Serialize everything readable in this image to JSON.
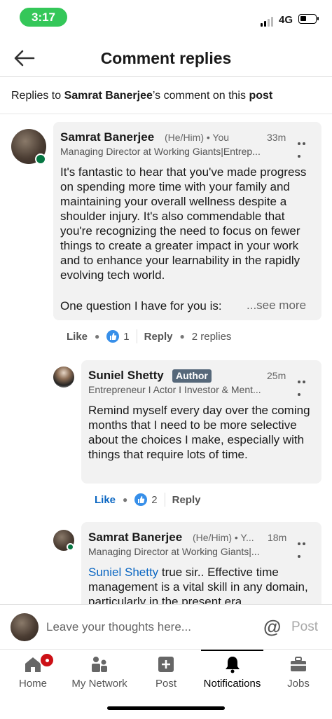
{
  "status_bar": {
    "time": "3:17",
    "network": "4G"
  },
  "header": {
    "title": "Comment replies"
  },
  "subheader": {
    "prefix": "Replies to ",
    "author": "Samrat Banerjee",
    "middle": "’s comment on this ",
    "post_word": "post"
  },
  "main_comment": {
    "name": "Samrat Banerjee",
    "pronoun": "(He/Him) • You",
    "time": "33m",
    "headline": "Managing Director at Working Giants|Entrep...",
    "text": "It's fantastic to hear that you've made progress on spending more time with your family and maintaining your overall wellness despite a shoulder injury. It's also commendable that you're recognizing the need to focus on fewer things to create a greater impact in your work and to enhance your learnability in the rapidly evolving tech world.",
    "last_line": "One question I have for you is:",
    "see_more": "...see more",
    "like_label": "Like",
    "like_count": "1",
    "reply_label": "Reply",
    "replies_count": "2 replies"
  },
  "reply_1": {
    "name": "Suniel Shetty",
    "badge": "Author",
    "time": "25m",
    "headline": "Entrepreneur I Actor I Investor & Ment...",
    "text": "Remind myself every day over the coming months that I need to be more selective about the choices I make, especially with things that require lots of time.",
    "like_label": "Like",
    "like_count": "2",
    "reply_label": "Reply"
  },
  "reply_2": {
    "name": "Samrat Banerjee",
    "pronoun": "(He/Him) • Y...",
    "time": "18m",
    "headline": "Managing Director at Working Giants|...",
    "mention": "Suniel Shetty",
    "text": " true sir.. Effective time management is a vital skill in any domain, particularly in the present era"
  },
  "composer": {
    "placeholder": "Leave your thoughts here...",
    "at_symbol": "@",
    "post_label": "Post"
  },
  "nav": {
    "items": [
      {
        "label": "Home",
        "icon": "home-icon"
      },
      {
        "label": "My Network",
        "icon": "network-icon"
      },
      {
        "label": "Post",
        "icon": "post-icon"
      },
      {
        "label": "Notifications",
        "icon": "bell-icon"
      },
      {
        "label": "Jobs",
        "icon": "briefcase-icon"
      }
    ],
    "active": "Notifications"
  },
  "colors": {
    "accent": "#0a66c2",
    "presence": "#057642",
    "status_pill": "#34c759",
    "badge_red": "#cc1016"
  }
}
